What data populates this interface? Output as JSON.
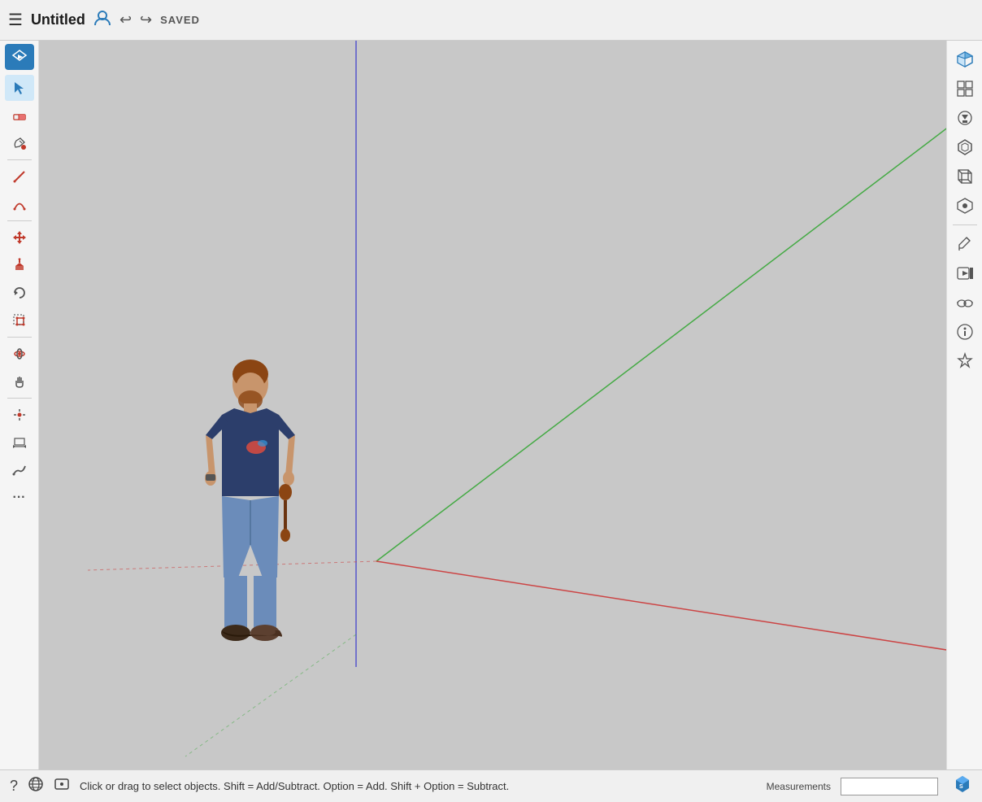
{
  "header": {
    "title": "Untitled",
    "saved_label": "SAVED",
    "undo_label": "↩",
    "redo_label": "↪"
  },
  "status_bar": {
    "status_text": "Click or drag to select objects. Shift = Add/Subtract. Option = Add. Shift + Option = Subtract.",
    "measurements_label": "Measurements"
  },
  "left_toolbar": {
    "tools": [
      {
        "name": "pin",
        "icon": "✈",
        "label": "Extension"
      },
      {
        "name": "select",
        "icon": "▲",
        "label": "Select",
        "active": true
      },
      {
        "name": "eraser",
        "icon": "◻",
        "label": "Eraser"
      },
      {
        "name": "paint",
        "icon": "⊙",
        "label": "Paint Bucket"
      },
      {
        "name": "pencil",
        "icon": "✏",
        "label": "Line"
      },
      {
        "name": "arc",
        "icon": "◕",
        "label": "Arc"
      },
      {
        "name": "move",
        "icon": "⊕",
        "label": "Move"
      },
      {
        "name": "push-pull",
        "icon": "⬆",
        "label": "Push/Pull"
      },
      {
        "name": "rotate",
        "icon": "↻",
        "label": "Rotate"
      },
      {
        "name": "scale",
        "icon": "⬛",
        "label": "Scale"
      },
      {
        "name": "orbit",
        "icon": "◎",
        "label": "Orbit"
      },
      {
        "name": "pan",
        "icon": "✋",
        "label": "Pan"
      },
      {
        "name": "point",
        "icon": "⊕",
        "label": "Point"
      },
      {
        "name": "dimension",
        "icon": "⊞",
        "label": "Dimension"
      },
      {
        "name": "curve",
        "icon": "〜",
        "label": "Freehand"
      },
      {
        "name": "more",
        "icon": "…",
        "label": "More"
      }
    ]
  },
  "right_toolbar": {
    "tools": [
      {
        "name": "views-cube",
        "icon": "⬡",
        "label": "Views Cube"
      },
      {
        "name": "views-standard",
        "icon": "⬜",
        "label": "Standard Views"
      },
      {
        "name": "views-grad",
        "icon": "🎓",
        "label": "Graduated"
      },
      {
        "name": "views-hex",
        "icon": "⬡",
        "label": "Hex View"
      },
      {
        "name": "views-3d",
        "icon": "▣",
        "label": "3D View"
      },
      {
        "name": "views-alt",
        "icon": "◈",
        "label": "Alt View"
      },
      {
        "name": "edit-icon",
        "icon": "✏",
        "label": "Edit"
      },
      {
        "name": "animation-icon",
        "icon": "▶",
        "label": "Animation"
      },
      {
        "name": "glasses-icon",
        "icon": "👓",
        "label": "VR/AR"
      },
      {
        "name": "info-icon",
        "icon": "ℹ",
        "label": "Info"
      },
      {
        "name": "extension-icon",
        "icon": "★",
        "label": "Extensions"
      }
    ]
  },
  "canvas": {
    "bg_color": "#c8c8c8",
    "axis_blue_color": "#4444cc",
    "axis_green_color": "#44aa44",
    "axis_red_color": "#cc4444",
    "axis_dotted_color": "#cc4444"
  }
}
